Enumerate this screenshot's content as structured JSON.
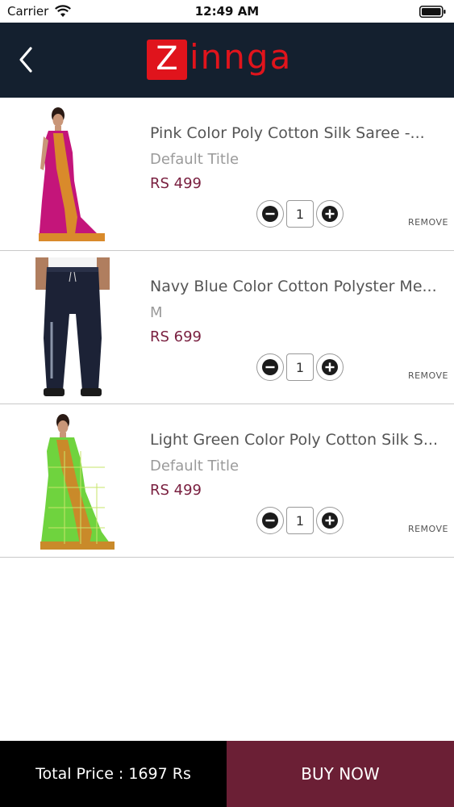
{
  "status_bar": {
    "carrier": "Carrier",
    "time": "12:49 AM"
  },
  "header": {
    "logo_letter": "Z",
    "logo_rest": "innga",
    "brand_color": "#e0141c",
    "background_color": "#14202f",
    "back_icon": "chevron-left-icon"
  },
  "cart": {
    "remove_label": "REMOVE",
    "items": [
      {
        "name": "Pink Color Poly Cotton Silk Saree  -...",
        "variant": "Default Title",
        "price": "RS 499",
        "quantity": "1",
        "image": "pink-saree"
      },
      {
        "name": "Navy Blue Color Cotton Polyster Me...",
        "variant": "M",
        "price": "RS 699",
        "quantity": "1",
        "image": "navy-track-pants"
      },
      {
        "name": "Light Green Color Poly Cotton Silk S...",
        "variant": "Default Title",
        "price": "RS 499",
        "quantity": "1",
        "image": "green-saree"
      }
    ]
  },
  "footer": {
    "total_label": "Total Price : 1697 Rs",
    "buy_now_label": "BUY NOW",
    "buy_now_color": "#6b1f35"
  }
}
